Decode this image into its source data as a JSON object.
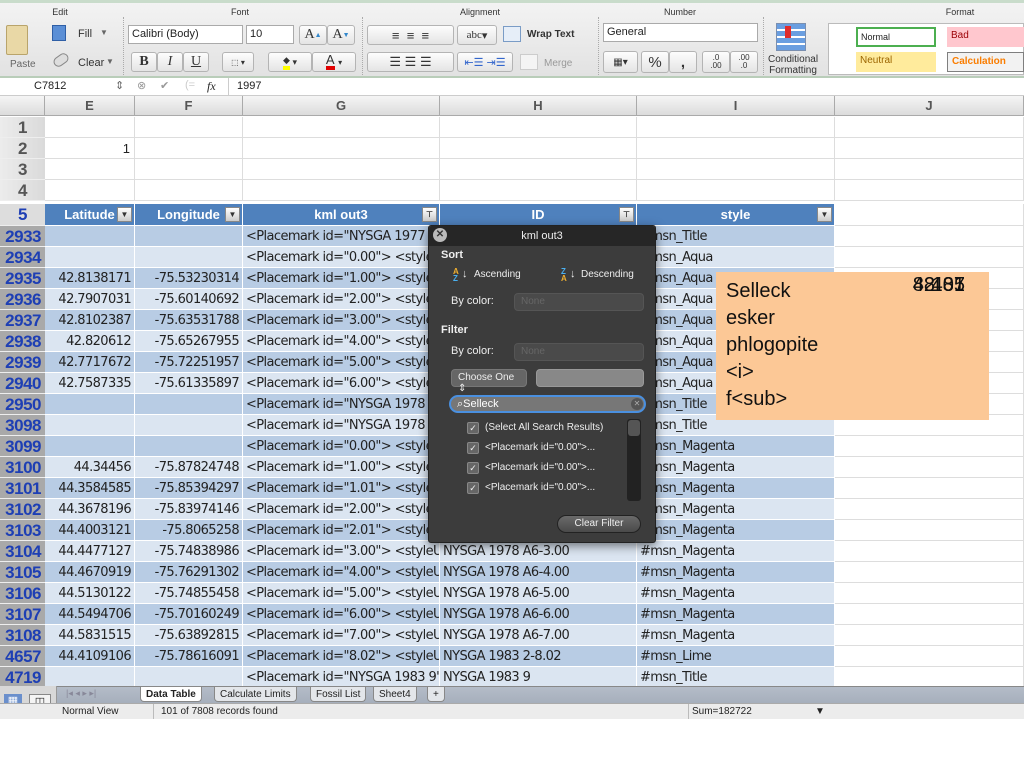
{
  "ribbon": {
    "groups": [
      "Edit",
      "Font",
      "Alignment",
      "Number",
      "Format"
    ],
    "paste": "Paste",
    "fill": "Fill",
    "clear": "Clear",
    "font_name": "Calibri (Body)",
    "font_size": "10",
    "bold": "B",
    "italic": "I",
    "underline": "U",
    "wrap_text": "Wrap Text",
    "merge": "Merge",
    "abc": "abc",
    "number_format": "General",
    "percent": "%",
    "comma": ",",
    "conditional_formatting": [
      "Conditional",
      "Formatting"
    ],
    "styles": {
      "normal": "Normal",
      "bad": "Bad",
      "neutral": "Neutral",
      "calculation": "Calculation"
    },
    "colors": {
      "fill": "#ffff00",
      "font": "#e00000",
      "bad_bg": "#ffc7ce",
      "bad_fg": "#9c0006",
      "neutral_bg": "#ffeb9c",
      "neutral_fg": "#9c6500",
      "calc_fg": "#fa7d00",
      "normal_border": "#4caf50"
    }
  },
  "formula_bar": {
    "cell_ref": "C7812",
    "fx": "fx",
    "value": "1997"
  },
  "columns": [
    "E",
    "F",
    "G",
    "H",
    "I",
    "J"
  ],
  "top_rows": [
    {
      "row": "1",
      "E": ""
    },
    {
      "row": "2",
      "E": "1"
    },
    {
      "row": "3",
      "E": ""
    },
    {
      "row": "4",
      "E": ""
    }
  ],
  "header_row": {
    "row": "5",
    "cols": [
      "Latitude",
      "Longitude",
      "kml out3",
      "ID",
      "style"
    ]
  },
  "rows": [
    {
      "row": "2933",
      "lat": "",
      "lon": "",
      "kml": "<Placemark id=\"NYSGA 1977 B",
      "id": "",
      "style": "#msn_Title"
    },
    {
      "row": "2934",
      "lat": "",
      "lon": "",
      "kml": "<Placemark id=\"0.00\">  <style",
      "id": "",
      "style": "#msn_Aqua"
    },
    {
      "row": "2935",
      "lat": "42.8138171",
      "lon": "-75.53230314",
      "kml": "<Placemark id=\"1.00\">  <style",
      "id": "",
      "style": "#msn_Aqua"
    },
    {
      "row": "2936",
      "lat": "42.7907031",
      "lon": "-75.60140692",
      "kml": "<Placemark id=\"2.00\">  <style",
      "id": "",
      "style": "#msn_Aqua"
    },
    {
      "row": "2937",
      "lat": "42.8102387",
      "lon": "-75.63531788",
      "kml": "<Placemark id=\"3.00\">  <style",
      "id": "",
      "style": "#msn_Aqua"
    },
    {
      "row": "2938",
      "lat": "42.820612",
      "lon": "-75.65267955",
      "kml": "<Placemark id=\"4.00\">  <style",
      "id": "",
      "style": "#msn_Aqua"
    },
    {
      "row": "2939",
      "lat": "42.7717672",
      "lon": "-75.72251957",
      "kml": "<Placemark id=\"5.00\">  <style",
      "id": "",
      "style": "#msn_Aqua"
    },
    {
      "row": "2940",
      "lat": "42.7587335",
      "lon": "-75.61335897",
      "kml": "<Placemark id=\"6.00\">  <style",
      "id": "",
      "style": "#msn_Aqua"
    },
    {
      "row": "2950",
      "lat": "",
      "lon": "",
      "kml": "<Placemark id=\"NYSGA 1978 A",
      "id": "",
      "style": "#msn_Title"
    },
    {
      "row": "3098",
      "lat": "",
      "lon": "",
      "kml": "<Placemark id=\"NYSGA 1978 A",
      "id": "",
      "style": "#msn_Title"
    },
    {
      "row": "3099",
      "lat": "",
      "lon": "",
      "kml": "<Placemark id=\"0.00\">  <style",
      "id": "",
      "style": "#msn_Magenta"
    },
    {
      "row": "3100",
      "lat": "44.34456",
      "lon": "-75.87824748",
      "kml": "<Placemark id=\"1.00\">  <style",
      "id": "",
      "style": "#msn_Magenta"
    },
    {
      "row": "3101",
      "lat": "44.3584585",
      "lon": "-75.85394297",
      "kml": "<Placemark id=\"1.01\">  <style",
      "id": "",
      "style": "#msn_Magenta"
    },
    {
      "row": "3102",
      "lat": "44.3678196",
      "lon": "-75.83974146",
      "kml": "<Placemark id=\"2.00\">  <style",
      "id": "",
      "style": "#msn_Magenta"
    },
    {
      "row": "3103",
      "lat": "44.4003121",
      "lon": "-75.8065258",
      "kml": "<Placemark id=\"2.01\">  <style",
      "id": "",
      "style": "#msn_Magenta"
    },
    {
      "row": "3104",
      "lat": "44.4477127",
      "lon": "-75.74838986",
      "kml": "<Placemark id=\"3.00\">  <styleU",
      "id": "NYSGA 1978 A6-3.00",
      "style": "#msn_Magenta"
    },
    {
      "row": "3105",
      "lat": "44.4670919",
      "lon": "-75.76291302",
      "kml": "<Placemark id=\"4.00\">  <styleU",
      "id": "NYSGA 1978 A6-4.00",
      "style": "#msn_Magenta"
    },
    {
      "row": "3106",
      "lat": "44.5130122",
      "lon": "-75.74855458",
      "kml": "<Placemark id=\"5.00\">  <styleU",
      "id": "NYSGA 1978 A6-5.00",
      "style": "#msn_Magenta"
    },
    {
      "row": "3107",
      "lat": "44.5494706",
      "lon": "-75.70160249",
      "kml": "<Placemark id=\"6.00\">  <styleU",
      "id": "NYSGA 1978 A6-6.00",
      "style": "#msn_Magenta"
    },
    {
      "row": "3108",
      "lat": "44.5831515",
      "lon": "-75.63892815",
      "kml": "<Placemark id=\"7.00\">  <styleU",
      "id": "NYSGA 1978 A6-7.00",
      "style": "#msn_Magenta"
    },
    {
      "row": "4657",
      "lat": "44.4109106",
      "lon": "-75.78616091",
      "kml": "<Placemark id=\"8.02\">  <styleU",
      "id": "NYSGA 1983 2-8.02",
      "style": "#msn_Lime"
    },
    {
      "row": "4719",
      "lat": "",
      "lon": "",
      "kml": "<Placemark id=\"NYSGA 1983 9\"",
      "id": "NYSGA 1983 9",
      "style": "#msn_Title"
    }
  ],
  "filter_popup": {
    "title": "kml out3",
    "sort_heading": "Sort",
    "ascending": "Ascending",
    "descending": "Descending",
    "by_color": "By color:",
    "sort_color_value": "None",
    "filter_heading": "Filter",
    "filter_color_value": "None",
    "choose_one": "Choose One",
    "search_value": "Selleck",
    "items": [
      {
        "label": "(Select All Search Results)",
        "checked": true
      },
      {
        "label": "<Placemark id=\"0.00\">...",
        "checked": true
      },
      {
        "label": "<Placemark id=\"0.00\">...",
        "checked": true
      },
      {
        "label": "<Placemark id=\"0.00\">...",
        "checked": true
      }
    ],
    "clear_filter": "Clear Filter"
  },
  "note": [
    {
      "word": "Selleck",
      "count": "101"
    },
    {
      "word": "esker",
      "count": "88"
    },
    {
      "word": "phlogopite",
      "count": "42"
    },
    {
      "word": "<i>",
      "count": "437"
    },
    {
      "word": "f<sub>",
      "count": "85"
    }
  ],
  "sheet_tabs": [
    "Data Table",
    "Calculate Limits",
    "Fossil List",
    "Sheet4",
    "+"
  ],
  "active_tab": "Data Table",
  "status": {
    "view": "Normal View",
    "records": "101 of 7808 records found",
    "sum": "Sum=182722"
  }
}
